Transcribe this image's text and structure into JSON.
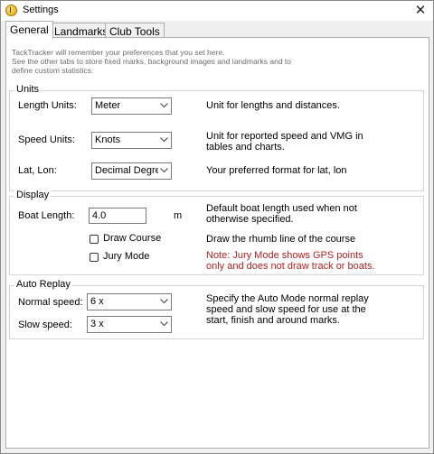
{
  "window": {
    "title": "Settings",
    "close_glyph": "✕"
  },
  "tabs": [
    {
      "label": "General",
      "active": true
    },
    {
      "label": "Landmarks",
      "active": false
    },
    {
      "label": "Club Tools",
      "active": false
    }
  ],
  "intro_lines": [
    "TackTracker will remember your preferences that you set here.",
    "See the other tabs to store fixed marks, background images and landmarks and to",
    "define custom statistics."
  ],
  "units": {
    "legend": "Units",
    "length_label": "Length Units:",
    "length_value": "Meter",
    "length_desc": "Unit for lengths and distances.",
    "speed_label": "Speed Units:",
    "speed_value": "Knots",
    "speed_desc": [
      "Unit for reported speed and VMG in",
      "tables and charts."
    ],
    "latlon_label": "Lat, Lon:",
    "latlon_value": "Decimal Degrees",
    "latlon_desc": "Your preferred format for lat, lon"
  },
  "display": {
    "legend": "Display",
    "boat_length_label": "Boat Length:",
    "boat_length_value": "4.0",
    "boat_length_unit": "m",
    "boat_length_desc": [
      "Default boat length used when not",
      "otherwise specified."
    ],
    "draw_course_label": "Draw Course",
    "draw_course_checked": false,
    "draw_course_desc": "Draw the rhumb line of the course",
    "jury_mode_label": "Jury Mode",
    "jury_mode_checked": false,
    "jury_note": [
      "Note: Jury Mode shows GPS points",
      "only and does not draw track or boats."
    ]
  },
  "auto_replay": {
    "legend": "Auto Replay",
    "normal_label": "Normal speed:",
    "normal_value": "6 x",
    "slow_label": "Slow speed:",
    "slow_value": "3 x",
    "desc": [
      "Specify the Auto Mode normal replay",
      "speed and slow speed for use at the",
      "start, finish and around marks."
    ]
  },
  "colors": {
    "note": "#b22222",
    "border": "#d5d5d5",
    "intro": "#6d6d6d"
  }
}
